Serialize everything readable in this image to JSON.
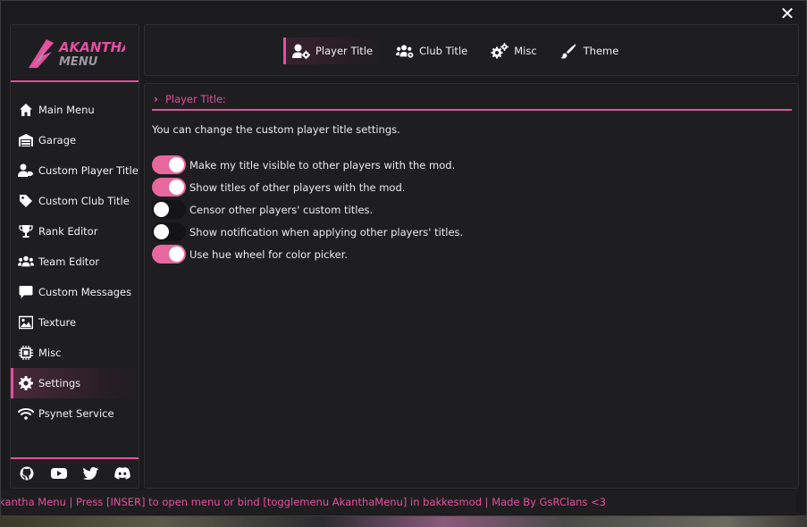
{
  "window": {
    "close_icon": "close-icon"
  },
  "brand": {
    "line1": "AKANTHA",
    "line2": "MENU",
    "accent": "#e64ea0"
  },
  "sidebar": {
    "items": [
      {
        "label": "Main Menu",
        "icon": "home-icon",
        "active": false
      },
      {
        "label": "Garage",
        "icon": "garage-icon",
        "active": false
      },
      {
        "label": "Custom Player Title",
        "icon": "user-tag-icon",
        "active": false
      },
      {
        "label": "Custom Club Title",
        "icon": "tag-icon",
        "active": false
      },
      {
        "label": "Rank Editor",
        "icon": "trophy-icon",
        "active": false
      },
      {
        "label": "Team Editor",
        "icon": "users-icon",
        "active": false
      },
      {
        "label": "Custom Messages",
        "icon": "comment-icon",
        "active": false
      },
      {
        "label": "Texture",
        "icon": "image-icon",
        "active": false
      },
      {
        "label": "Misc",
        "icon": "chip-icon",
        "active": false
      },
      {
        "label": "Settings",
        "icon": "gear-icon",
        "active": true
      },
      {
        "label": "Psynet Service",
        "icon": "wifi-icon",
        "active": false
      }
    ],
    "social": [
      "github-icon",
      "youtube-icon",
      "twitter-icon",
      "discord-icon"
    ]
  },
  "tabs": [
    {
      "label": "Player Title",
      "icon": "user-gear-icon",
      "active": true
    },
    {
      "label": "Club Title",
      "icon": "users-gear-icon",
      "active": false
    },
    {
      "label": "Misc",
      "icon": "gears-icon",
      "active": false
    },
    {
      "label": "Theme",
      "icon": "brush-icon",
      "active": false
    }
  ],
  "section": {
    "title": "Player Title:",
    "description": "You can change the custom player title settings.",
    "toggles": [
      {
        "label": "Make my title visible to other players with the mod.",
        "on": true
      },
      {
        "label": "Show titles of other players with the mod.",
        "on": true
      },
      {
        "label": "Censor other players' custom titles.",
        "on": false
      },
      {
        "label": "Show notification when applying other players' titles.",
        "on": false
      },
      {
        "label": "Use hue wheel for color picker.",
        "on": true
      }
    ]
  },
  "status": {
    "text": "kantha Menu | Press [INSER] to open menu or bind [togglemenu AkanthaMenu] in bakkesmod | Made By GsRClans <3"
  }
}
